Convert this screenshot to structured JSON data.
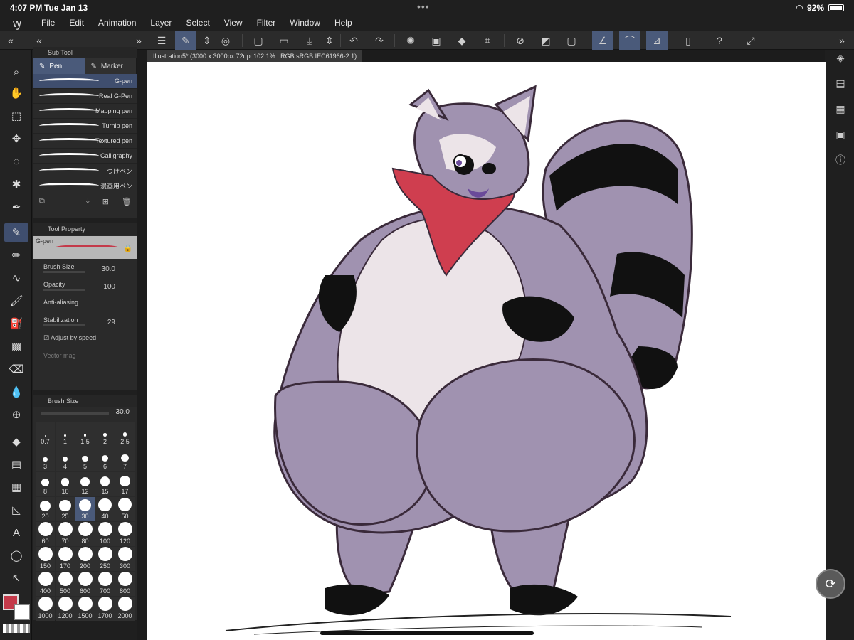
{
  "status": {
    "time": "4:07 PM",
    "date": "Tue Jan 13",
    "battery": "92%"
  },
  "menu": [
    "File",
    "Edit",
    "Animation",
    "Layer",
    "Select",
    "View",
    "Filter",
    "Window",
    "Help"
  ],
  "document_tab": "Illustration5* (3000 x 3000px 72dpi 102.1% : RGB:sRGB IEC61966-2.1)",
  "subtool": {
    "header": "Sub Tool",
    "tabs": [
      "Pen",
      "Marker"
    ],
    "brushes": [
      "G-pen",
      "Real G-Pen",
      "Mapping pen",
      "Turnip pen",
      "Textured pen",
      "Calligraphy",
      "つけペン",
      "漫画用ペン"
    ]
  },
  "tool_property": {
    "header": "Tool Property",
    "preset": "G-pen",
    "brush_size_label": "Brush Size",
    "brush_size": "30.0",
    "opacity_label": "Opacity",
    "opacity": "100",
    "anti_alias_label": "Anti-aliasing",
    "stabilization_label": "Stabilization",
    "stabilization": "29",
    "adjust_speed_label": "Adjust by speed",
    "vector_label": "Vector mag"
  },
  "brush_size_panel": {
    "header": "Brush Size",
    "value": "30.0",
    "sizes": [
      "0.7",
      "1",
      "1.5",
      "2",
      "2.5",
      "3",
      "4",
      "5",
      "6",
      "7",
      "8",
      "10",
      "12",
      "15",
      "17",
      "20",
      "25",
      "30",
      "40",
      "50",
      "60",
      "70",
      "80",
      "100",
      "120",
      "150",
      "170",
      "200",
      "250",
      "300",
      "400",
      "500",
      "600",
      "700",
      "800",
      "1000",
      "1200",
      "1500",
      "1700",
      "2000"
    ],
    "selected": "30"
  },
  "colors": {
    "main": "#c43a4a",
    "sub": "#ffffff",
    "accent": "#4a5a7a"
  }
}
